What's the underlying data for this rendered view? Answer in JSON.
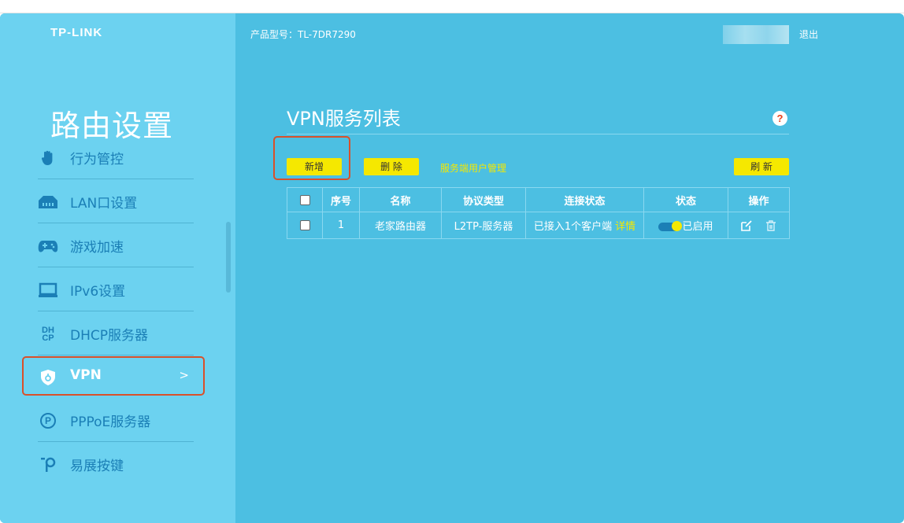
{
  "brand": {
    "logo": "TP-LINK"
  },
  "header": {
    "model_label": "产品型号：TL-7DR7290",
    "logout_label": "退出"
  },
  "sidebar": {
    "title": "路由设置",
    "items": [
      {
        "label": "行为管控",
        "icon": "hand-icon"
      },
      {
        "label": "LAN口设置",
        "icon": "lan-port-icon"
      },
      {
        "label": "游戏加速",
        "icon": "gamepad-icon"
      },
      {
        "label": "IPv6设置",
        "icon": "monitor-icon"
      },
      {
        "label": "DHCP服务器",
        "icon": "dhcp-icon",
        "icon_text_top": "DH",
        "icon_text_bottom": "CP"
      },
      {
        "label": "VPN",
        "icon": "shield-icon",
        "active": true,
        "chevron": ">"
      },
      {
        "label": "PPPoE服务器",
        "icon": "pppoe-icon",
        "icon_text": "P"
      },
      {
        "label": "易展按键",
        "icon": "easymesh-button-icon"
      }
    ]
  },
  "main": {
    "title": "VPN服务列表",
    "help_icon": "?",
    "toolbar": {
      "add_label": "新增",
      "delete_label": "删 除",
      "users_link": "服务端用户管理",
      "refresh_label": "刷 新"
    },
    "table": {
      "headers": [
        "",
        "序号",
        "名称",
        "协议类型",
        "连接状态",
        "状态",
        "操作"
      ],
      "rows": [
        {
          "index": "1",
          "name": "老家路由器",
          "protocol": "L2TP-服务器",
          "connection": "已接入1个客户端",
          "detail_link": "详情",
          "status": "已启用",
          "enabled": true
        }
      ]
    }
  },
  "colors": {
    "sidebar_bg": "#6cd2f0",
    "main_bg": "#4cbfe2",
    "accent_yellow": "#f5e800",
    "menu_text": "#1b7fb6",
    "highlight_border": "#d9502a"
  }
}
